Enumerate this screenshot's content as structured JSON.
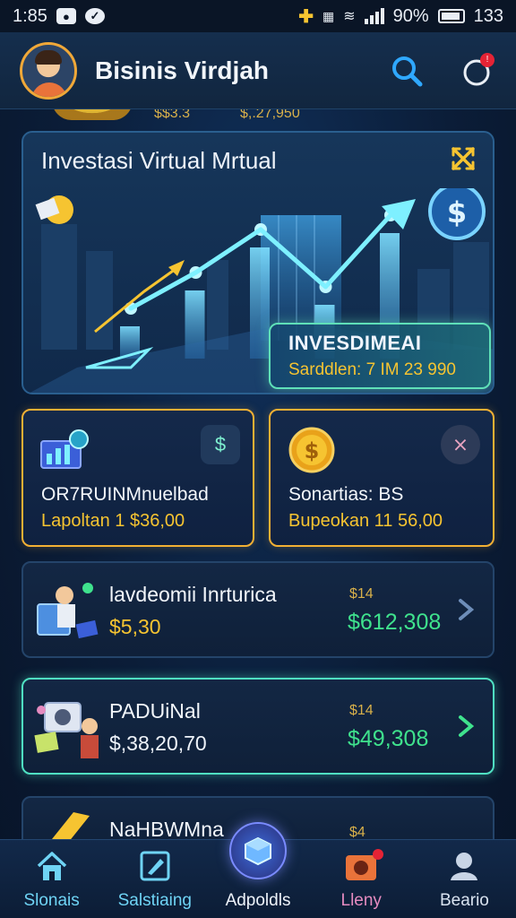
{
  "status_bar": {
    "time": "1:85",
    "battery_percent": "90%",
    "clock_right": "133"
  },
  "header": {
    "title": "Bisinis Virdjah"
  },
  "top_strip": {
    "amount_1": "$$3.3",
    "amount_2": "$,.27,950"
  },
  "hero": {
    "title": "Investasi Virtual Mrtual",
    "summary_label": "INVESDIMEAI",
    "summary_value": "Sarddlen: 7 IM 23 990",
    "chart_points": [
      0.35,
      0.6,
      0.9,
      0.5,
      1.0
    ]
  },
  "stats": [
    {
      "name": "OR7RUINMnuelbad",
      "value": "Lapoltan 1 $36,00",
      "badge": "$"
    },
    {
      "name": "Sonartias: BS",
      "value": "Bupeokan 11 56,00",
      "badge": "⨯"
    }
  ],
  "rows": [
    {
      "title": "lavdeomii Inrturica",
      "amount": "$5,30",
      "small": "$14",
      "value": "$612,308"
    },
    {
      "title": "PADUiNal",
      "amount": "$,38,20,70",
      "small": "$14",
      "value": "$49,308"
    },
    {
      "title": "NaHBWMna",
      "small": "$4"
    }
  ],
  "nav": [
    {
      "label": "Slonais",
      "icon": "home-icon"
    },
    {
      "label": "Salstiaing",
      "icon": "edit-icon"
    },
    {
      "label": "Adpoldls",
      "icon": "cube-icon"
    },
    {
      "label": "Lleny",
      "icon": "camera-icon"
    },
    {
      "label": "Beario",
      "icon": "user-icon"
    }
  ],
  "colors": {
    "accent_gold": "#f6c431",
    "accent_green": "#3fe28d",
    "accent_teal": "#4fe0c2",
    "accent_blue": "#6fd4f5"
  }
}
